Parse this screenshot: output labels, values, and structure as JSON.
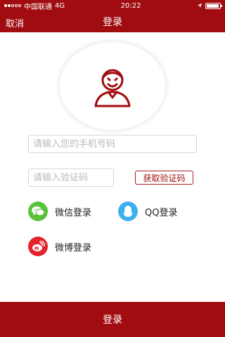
{
  "status_bar": {
    "carrier": "中国联通",
    "network": "4G",
    "time": "20:22"
  },
  "nav": {
    "cancel": "取消",
    "title": "登录"
  },
  "form": {
    "phone_placeholder": "请输入您的手机号码",
    "code_placeholder": "请输入验证码",
    "get_code": "获取验证码"
  },
  "social": {
    "wechat": "微信登录",
    "qq": "QQ登录",
    "weibo": "微博登录"
  },
  "login_button": "登录",
  "colors": {
    "brand": "#a00c10",
    "wechat": "#59c13a",
    "qq": "#3eb0ee",
    "weibo": "#e4232b"
  },
  "icons": {
    "avatar": "user-avatar-icon",
    "wechat": "wechat-icon",
    "qq": "qq-penguin-icon",
    "weibo": "weibo-icon"
  }
}
